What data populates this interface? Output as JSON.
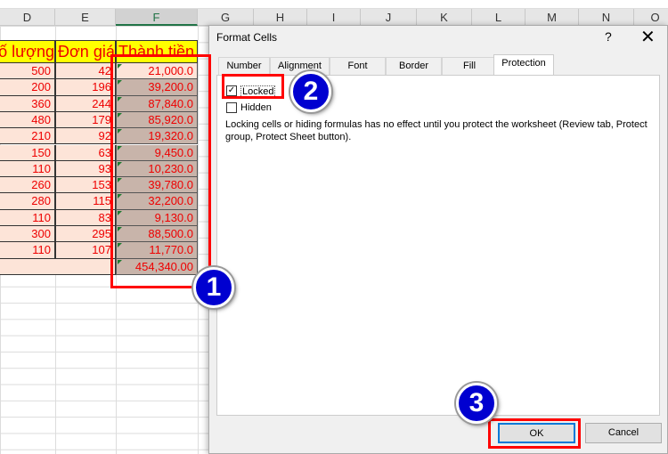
{
  "sheet": {
    "columns": [
      "D",
      "E",
      "F",
      "G",
      "H",
      "I",
      "J",
      "K",
      "L",
      "M",
      "N",
      "O"
    ],
    "selected_column": "F",
    "headers": [
      "ố lượng",
      "Đơn giá",
      "Thành tiền"
    ],
    "rows": [
      [
        "500",
        "42",
        "21,000.0"
      ],
      [
        "200",
        "196",
        "39,200.0"
      ],
      [
        "360",
        "244",
        "87,840.0"
      ],
      [
        "480",
        "179",
        "85,920.0"
      ],
      [
        "210",
        "92",
        "19,320.0"
      ],
      [
        "150",
        "63",
        "9,450.0"
      ],
      [
        "110",
        "93",
        "10,230.0"
      ],
      [
        "260",
        "153",
        "39,780.0"
      ],
      [
        "280",
        "115",
        "32,200.0"
      ],
      [
        "110",
        "83",
        "9,130.0"
      ],
      [
        "300",
        "295",
        "88,500.0"
      ],
      [
        "110",
        "107",
        "11,770.0"
      ]
    ],
    "total": "454,340.00"
  },
  "dialog": {
    "title": "Format Cells",
    "help": "?",
    "close": "✕",
    "tabs": [
      "Number",
      "Alignment",
      "Font",
      "Border",
      "Fill",
      "Protection"
    ],
    "active_tab": "Protection",
    "locked": {
      "label": "Locked",
      "checked": true
    },
    "hidden": {
      "label": "Hidden",
      "checked": false
    },
    "description": "Locking cells or hiding formulas has no effect until you protect the worksheet (Review tab, Protect group, Protect Sheet button).",
    "ok": "OK",
    "cancel": "Cancel"
  },
  "annotations": [
    "1",
    "2",
    "3"
  ],
  "colors": {
    "highlight": "#ff0000",
    "badge": "#0000d0",
    "header_fill": "#ffff00"
  }
}
